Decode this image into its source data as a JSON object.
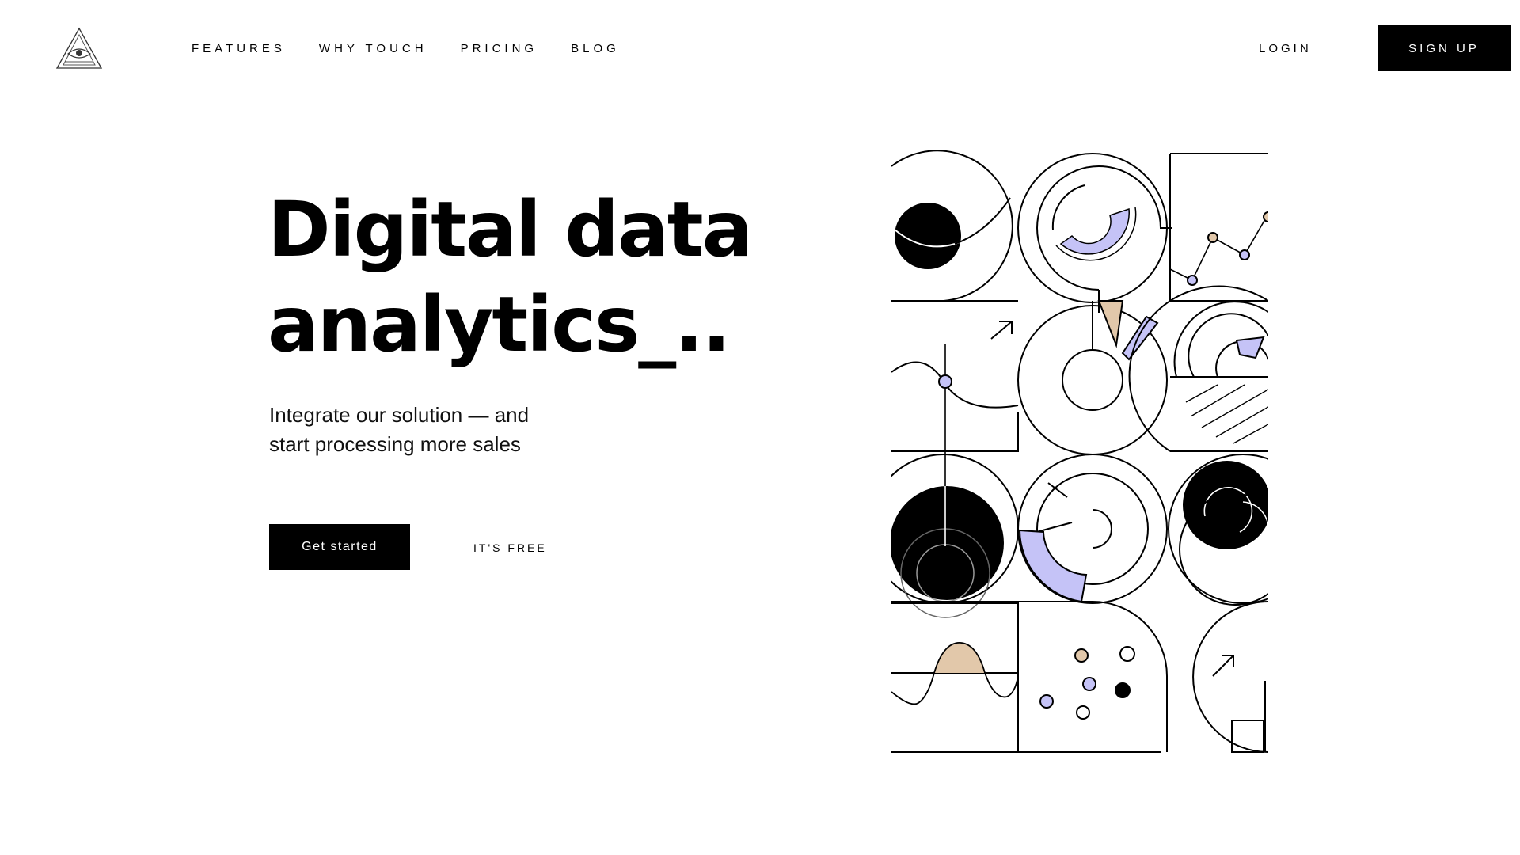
{
  "nav": {
    "items": [
      {
        "label": "FEATURES"
      },
      {
        "label": "WHY TOUCH"
      },
      {
        "label": "PRICING"
      },
      {
        "label": "BLOG"
      }
    ],
    "login_label": "LOGIN",
    "signup_label": "SIGN UP"
  },
  "hero": {
    "title_line1": "Digital data",
    "title_line2": "analytics_..",
    "subtitle_line1": "Integrate our solution — and",
    "subtitle_line2": "start processing more sales",
    "cta_label": "Get started",
    "free_label": "IT'S FREE"
  },
  "colors": {
    "primary": "#000000",
    "background": "#ffffff",
    "lavender": "#c5c3f7",
    "sand": "#e2c8aa"
  },
  "icons": {
    "logo": "eye-triangle-logo-icon"
  }
}
